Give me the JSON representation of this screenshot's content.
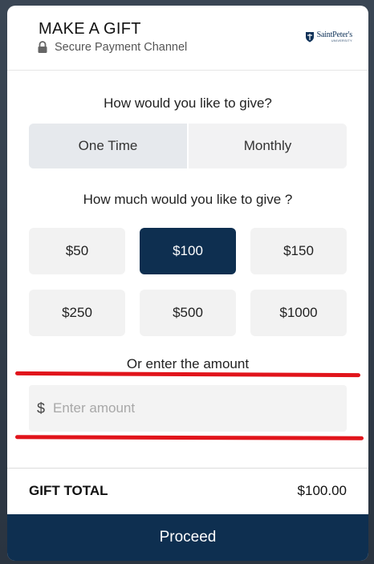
{
  "header": {
    "title": "MAKE A GIFT",
    "secure_text": "Secure Payment Channel",
    "logo_name": "SaintPeter's",
    "logo_sub": "UNIVERSITY"
  },
  "frequency": {
    "question": "How would you like to give?",
    "options": [
      {
        "label": "One Time",
        "selected": true
      },
      {
        "label": "Monthly",
        "selected": false
      }
    ]
  },
  "amount": {
    "question": "How much would you like to give ?",
    "options": [
      {
        "label": "$50",
        "selected": false
      },
      {
        "label": "$100",
        "selected": true
      },
      {
        "label": "$150",
        "selected": false
      },
      {
        "label": "$250",
        "selected": false
      },
      {
        "label": "$500",
        "selected": false
      },
      {
        "label": "$1000",
        "selected": false
      }
    ],
    "custom_label": "Or enter the amount",
    "currency_symbol": "$",
    "custom_placeholder": "Enter amount",
    "custom_value": ""
  },
  "total": {
    "label": "GIFT TOTAL",
    "value": "$100.00"
  },
  "proceed_label": "Proceed",
  "colors": {
    "primary": "#0e2f50",
    "annotation": "#e1141b",
    "button_bg": "#f2f2f2"
  },
  "icons": {
    "lock": "lock-icon",
    "logo": "shield-icon"
  }
}
